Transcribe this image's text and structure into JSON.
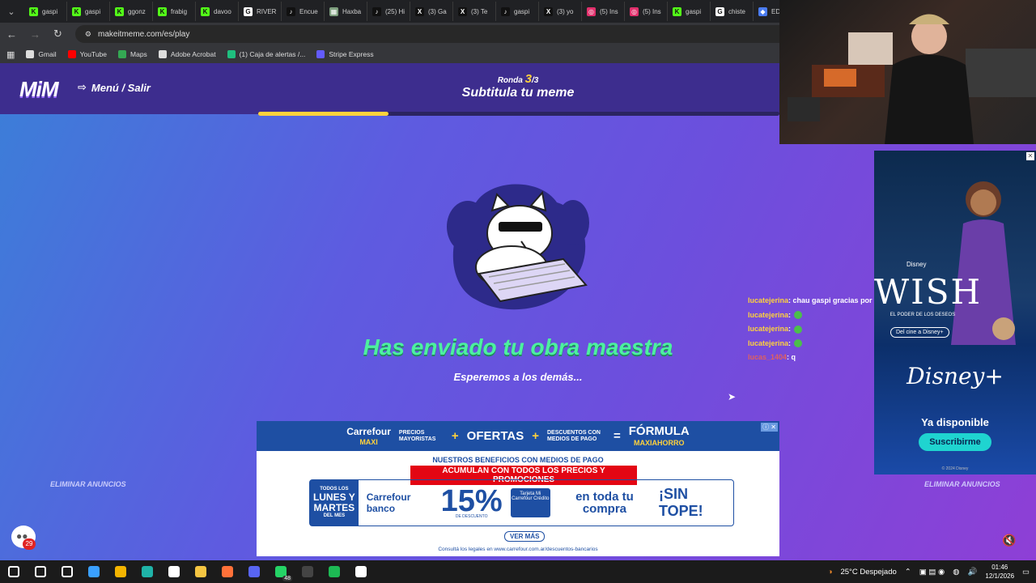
{
  "browser": {
    "tabs": [
      {
        "label": "gaspi",
        "color": "#53fc18",
        "glyph": "K"
      },
      {
        "label": "gaspi",
        "color": "#53fc18",
        "glyph": "K"
      },
      {
        "label": "ggonz",
        "color": "#53fc18",
        "glyph": "K"
      },
      {
        "label": "frabig",
        "color": "#53fc18",
        "glyph": "K"
      },
      {
        "label": "davoo",
        "color": "#53fc18",
        "glyph": "K"
      },
      {
        "label": "RIVER",
        "color": "#ffffff",
        "glyph": "G"
      },
      {
        "label": "Encue",
        "color": "#111111",
        "glyph": "♪"
      },
      {
        "label": "Haxba",
        "color": "#7fa07f",
        "glyph": "▦"
      },
      {
        "label": "(25) Hi",
        "color": "#111111",
        "glyph": "♪"
      },
      {
        "label": "(3) Ga",
        "color": "#111111",
        "glyph": "X"
      },
      {
        "label": "(3) Te",
        "color": "#111111",
        "glyph": "X"
      },
      {
        "label": "gaspi",
        "color": "#111111",
        "glyph": "♪"
      },
      {
        "label": "(3) yo",
        "color": "#111111",
        "glyph": "X"
      },
      {
        "label": "(5) Ins",
        "color": "#e1306c",
        "glyph": "◎"
      },
      {
        "label": "(5) Ins",
        "color": "#e1306c",
        "glyph": "◎"
      },
      {
        "label": "gaspi",
        "color": "#53fc18",
        "glyph": "K"
      },
      {
        "label": "chiste",
        "color": "#ffffff",
        "glyph": "G"
      },
      {
        "label": "EDICI",
        "color": "#4a7cf0",
        "glyph": "◆"
      }
    ],
    "url": "makeitmeme.com/es/play",
    "bookmarks": [
      {
        "label": "Gmail",
        "color": "#dddddd"
      },
      {
        "label": "YouTube",
        "color": "#ff0000"
      },
      {
        "label": "Maps",
        "color": "#34a853"
      },
      {
        "label": "Adobe Acrobat",
        "color": "#dddddd"
      },
      {
        "label": "(1) Caja de alertas /...",
        "color": "#1fbf7f"
      },
      {
        "label": "Stripe Express",
        "color": "#635bff"
      }
    ]
  },
  "game": {
    "logo": "MiM",
    "menu_label": "Menú / Salir",
    "round_label": "Ronda",
    "round_current": "3",
    "round_total": "/3",
    "round_title": "Subtitula tu meme",
    "progress_fraction": 0.25,
    "sent_message": "Has enviado tu obra maestra",
    "wait_message": "Esperemos a los demás...",
    "remove_ads": "ELIMINAR ANUNCIOS",
    "notification_count": "29"
  },
  "ad_carrefour": {
    "brand": "Carrefour",
    "brand_sub": "MAXI",
    "precios": "PRECIOS MAYORISTAS",
    "ofertas": "OFERTAS",
    "descuentos": "DESCUENTOS CON MEDIOS DE PAGO",
    "formula": "FÓRMULA",
    "formula_sub": "MAXIAHORRO",
    "line1": "NUESTROS BENEFICIOS CON MEDIOS DE PAGO",
    "line2": "ACUMULAN CON TODOS LOS PRECIOS Y PROMOCIONES",
    "todos_los": "TODOS LOS",
    "lunes_martes": "LUNES Y MARTES",
    "del_mes": "DEL MES",
    "brand_banco": "Carrefour banco",
    "percent": "15%",
    "descuento": "DE DESCUENTO",
    "card": "Tarjeta Mi Carrefour Crédito",
    "en_toda": "en toda tu compra",
    "sin_tope": "¡SIN TOPE!",
    "ver_mas": "VER MÁS",
    "legal": "Consultá los legales en www.carrefour.com.ar/descuentos-bancarios"
  },
  "chat": [
    {
      "user": "lucatejerina",
      "text": ": chau gaspi gracias por banear",
      "emote": false,
      "userColor": "#ffd23c"
    },
    {
      "user": "lucatejerina",
      "text": ":",
      "emote": true,
      "userColor": "#ffd23c"
    },
    {
      "user": "lucatejerina",
      "text": ":",
      "emote": true,
      "userColor": "#ffd23c"
    },
    {
      "user": "lucatejerina",
      "text": ":",
      "emote": true,
      "userColor": "#ffd23c"
    },
    {
      "user": "lucas_1404",
      "text": ": q",
      "emote": false,
      "userColor": "#e06060"
    }
  ],
  "ad_disney": {
    "disney_small": "Disney",
    "title": "WISH",
    "subtitle": "EL PODER DE LOS DESEOS",
    "cine": "Del cine a Disney+",
    "logo": "Disney+",
    "available": "Ya disponible",
    "button": "Suscribirme",
    "copyright": "© 2024 Disney"
  },
  "taskbar": {
    "icons": [
      {
        "name": "windows-start-icon",
        "color": "#ffffff"
      },
      {
        "name": "search-icon",
        "color": "#ffffff"
      },
      {
        "name": "task-view-icon",
        "color": "#ffffff"
      },
      {
        "name": "copilot-icon",
        "color": "#3aa0ff"
      },
      {
        "name": "chrome-icon",
        "color": "#f4b400"
      },
      {
        "name": "edge-icon",
        "color": "#1fb3a8"
      },
      {
        "name": "store-icon",
        "color": "#ffffff"
      },
      {
        "name": "file-explorer-icon",
        "color": "#f5c542"
      },
      {
        "name": "firefox-icon",
        "color": "#ff7139"
      },
      {
        "name": "discord-icon",
        "color": "#5865f2"
      },
      {
        "name": "whatsapp-icon",
        "color": "#25d366"
      },
      {
        "name": "obs-icon",
        "color": "#444444"
      },
      {
        "name": "spotify-icon",
        "color": "#1db954"
      },
      {
        "name": "capcut-icon",
        "color": "#ffffff"
      }
    ],
    "whatsapp_badge": "48",
    "weather": "25°C  Despejado",
    "time": "01:46",
    "date": "12/1/2026"
  }
}
